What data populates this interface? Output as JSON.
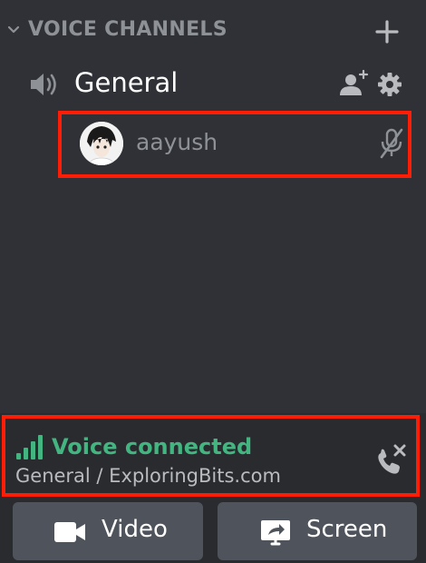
{
  "category": {
    "title": "VOICE CHANNELS",
    "collapse_icon": "chevron-down-icon",
    "add_icon": "plus-icon"
  },
  "channel": {
    "name": "General",
    "type_icon": "speaker-icon",
    "invite_icon": "add-user-icon",
    "settings_icon": "gear-icon"
  },
  "voice_users": [
    {
      "name": "aayush",
      "avatar_icon": "avatar",
      "status_icon": "microphone-muted-icon"
    }
  ],
  "voice_panel": {
    "status": "Voice connected",
    "location": "General / ExploringBits.com",
    "signal_icon": "signal-bars-icon",
    "disconnect_icon": "phone-disconnect-icon"
  },
  "buttons": {
    "video_label": "Video",
    "screen_label": "Screen"
  },
  "colors": {
    "background": "#2f3136",
    "panel": "#292b2f",
    "muted_text": "#8e9297",
    "connected_green": "#43b581",
    "highlight_red": "#ff1e05",
    "button_bg": "#4f545c"
  }
}
